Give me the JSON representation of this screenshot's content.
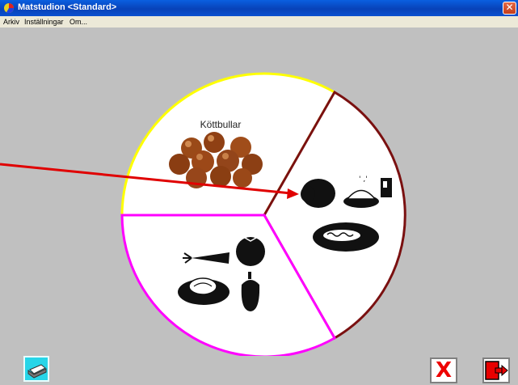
{
  "window": {
    "title": "Matstudion <Standard>",
    "close_glyph": "✕"
  },
  "menu": {
    "items": [
      "Arkiv",
      "Inställningar",
      "Om..."
    ]
  },
  "plate": {
    "sections": [
      {
        "name": "meat",
        "label": "Köttbullar",
        "border_color": "#ffff00",
        "items": [
          "meatballs-icon"
        ]
      },
      {
        "name": "carbs",
        "label": "",
        "border_color": "#7a1010",
        "items": [
          "potato-icon",
          "rice-icon",
          "bread-icon",
          "pasta-icon"
        ]
      },
      {
        "name": "vegetables",
        "label": "",
        "border_color": "#ff00ff",
        "items": [
          "carrot-icon",
          "tomato-icon",
          "lettuce-icon",
          "pepper-icon"
        ]
      }
    ],
    "pointer_arrow_color": "#e00000"
  },
  "buttons": {
    "print": "printer-icon",
    "cancel_label": "X",
    "exit": "exit-door-icon"
  }
}
